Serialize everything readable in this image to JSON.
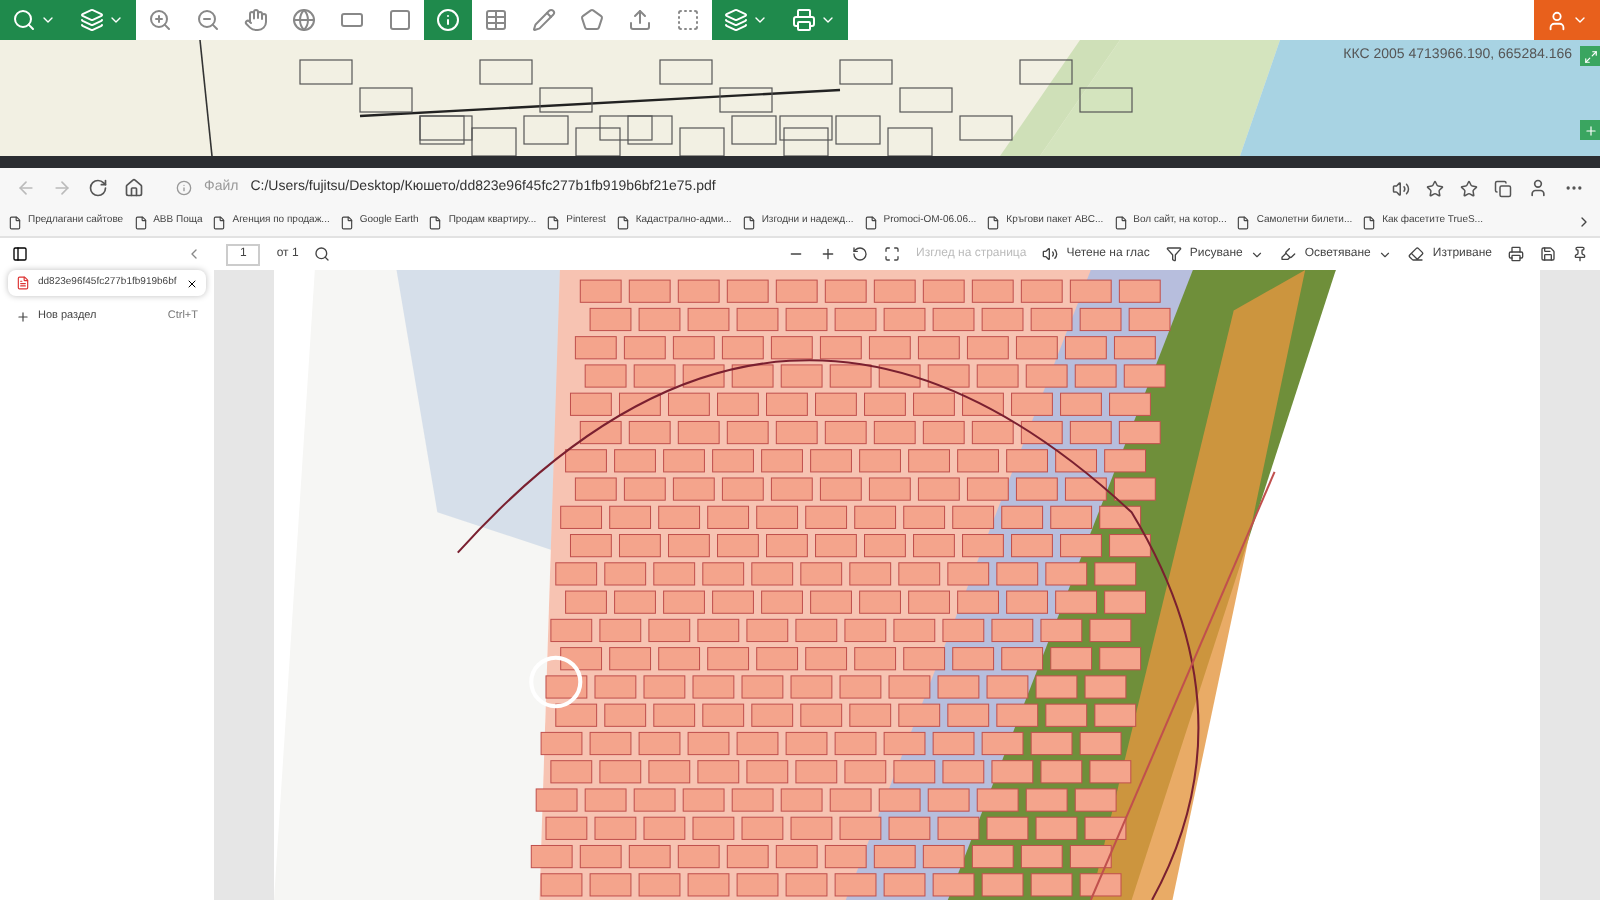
{
  "map": {
    "coordinates": "ККС 2005 4713966.190, 665284.166"
  },
  "browser": {
    "file_label": "Файл",
    "url": "C:/Users/fujitsu/Desktop/Кюшето/dd823e96f45fc277b1fb919b6bf21e75.pdf",
    "bookmarks": [
      "Предлагани сайтове",
      "ABB Поща",
      "Агенция по продаж...",
      "Google Earth",
      "Продам квартиру...",
      "Pinterest",
      "Кадастрално-адми...",
      "Изгодни и надежд...",
      "Promoci-OM-06.06...",
      "Кръгови пакет АВС...",
      "Вол сайт, на котор...",
      "Самолетни билети...",
      "Как фасетите TrueS..."
    ],
    "pdf_toolbar": {
      "page": "1",
      "of": "от 1",
      "page_view": "Изглед на страница",
      "read_aloud": "Четене на глас",
      "draw": "Рисуване",
      "highlight": "Осветяване",
      "erase": "Изтриване"
    },
    "sidebar": {
      "tab": "dd823e96f45fc277b1fb919b6bf",
      "new_tab": "Нов раздел",
      "shortcut": "Ctrl+T"
    }
  }
}
